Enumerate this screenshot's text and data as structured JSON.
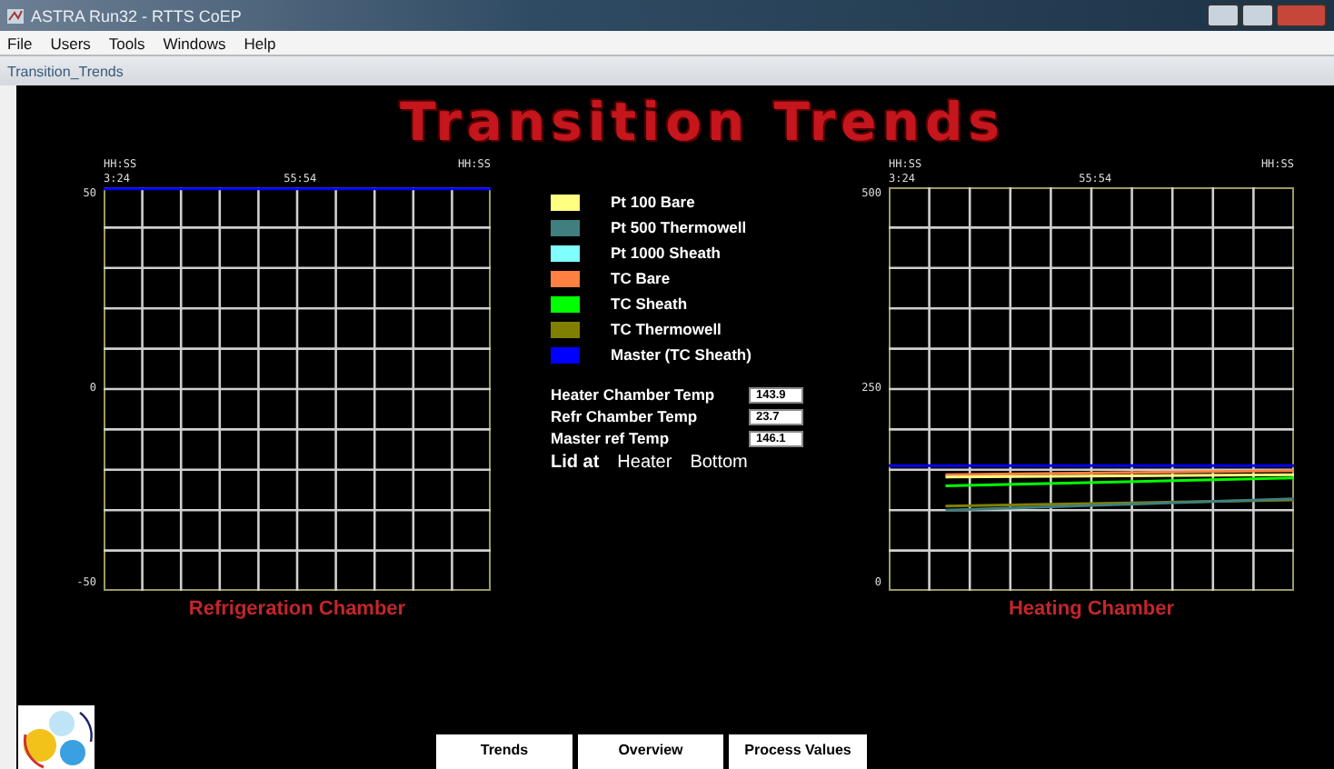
{
  "window": {
    "title": "ASTRA Run32 - RTTS CoEP"
  },
  "menu": [
    "File",
    "Users",
    "Tools",
    "Windows",
    "Help"
  ],
  "document_tab": "Transition_Trends",
  "heading": "Transition Trends",
  "refrigeration_chart": {
    "title": "Refrigeration Chamber",
    "time_unit_left": "HH:SS",
    "time_unit_right": "HH:SS",
    "start_time": "3:24",
    "mid_time": "55:54",
    "y_axis_labels": [
      "50",
      "0",
      "-50"
    ]
  },
  "legend": [
    {
      "label": "Pt 100 Bare",
      "color": "#ffff80"
    },
    {
      "label": "Pt 500 Thermowell",
      "color": "#3f7f7f"
    },
    {
      "label": "Pt 1000 Sheath",
      "color": "#80ffff"
    },
    {
      "label": "TC Bare",
      "color": "#ff8040"
    },
    {
      "label": "TC Sheath",
      "color": "#00ff00"
    },
    {
      "label": "TC Thermowell",
      "color": "#808000"
    },
    {
      "label": "Master (TC Sheath)",
      "color": "#0000ff"
    }
  ],
  "readings": [
    {
      "label": "Heater Chamber Temp",
      "value": "143.9"
    },
    {
      "label": "Refr Chamber Temp",
      "value": "23.7"
    },
    {
      "label": "Master ref Temp",
      "value": "146.1"
    }
  ],
  "lid": {
    "label": "Lid at",
    "chamber": "Heater",
    "position": "Bottom"
  },
  "heating_chart": {
    "title": "Heating Chamber",
    "time_unit_left": "HH:SS",
    "time_unit_right": "HH:SS",
    "start_time": "3:24",
    "mid_time": "55:54",
    "y_axis_labels": [
      "500",
      "250",
      "0"
    ]
  },
  "buttons": [
    "Trends",
    "Overview",
    "Process Values"
  ]
}
